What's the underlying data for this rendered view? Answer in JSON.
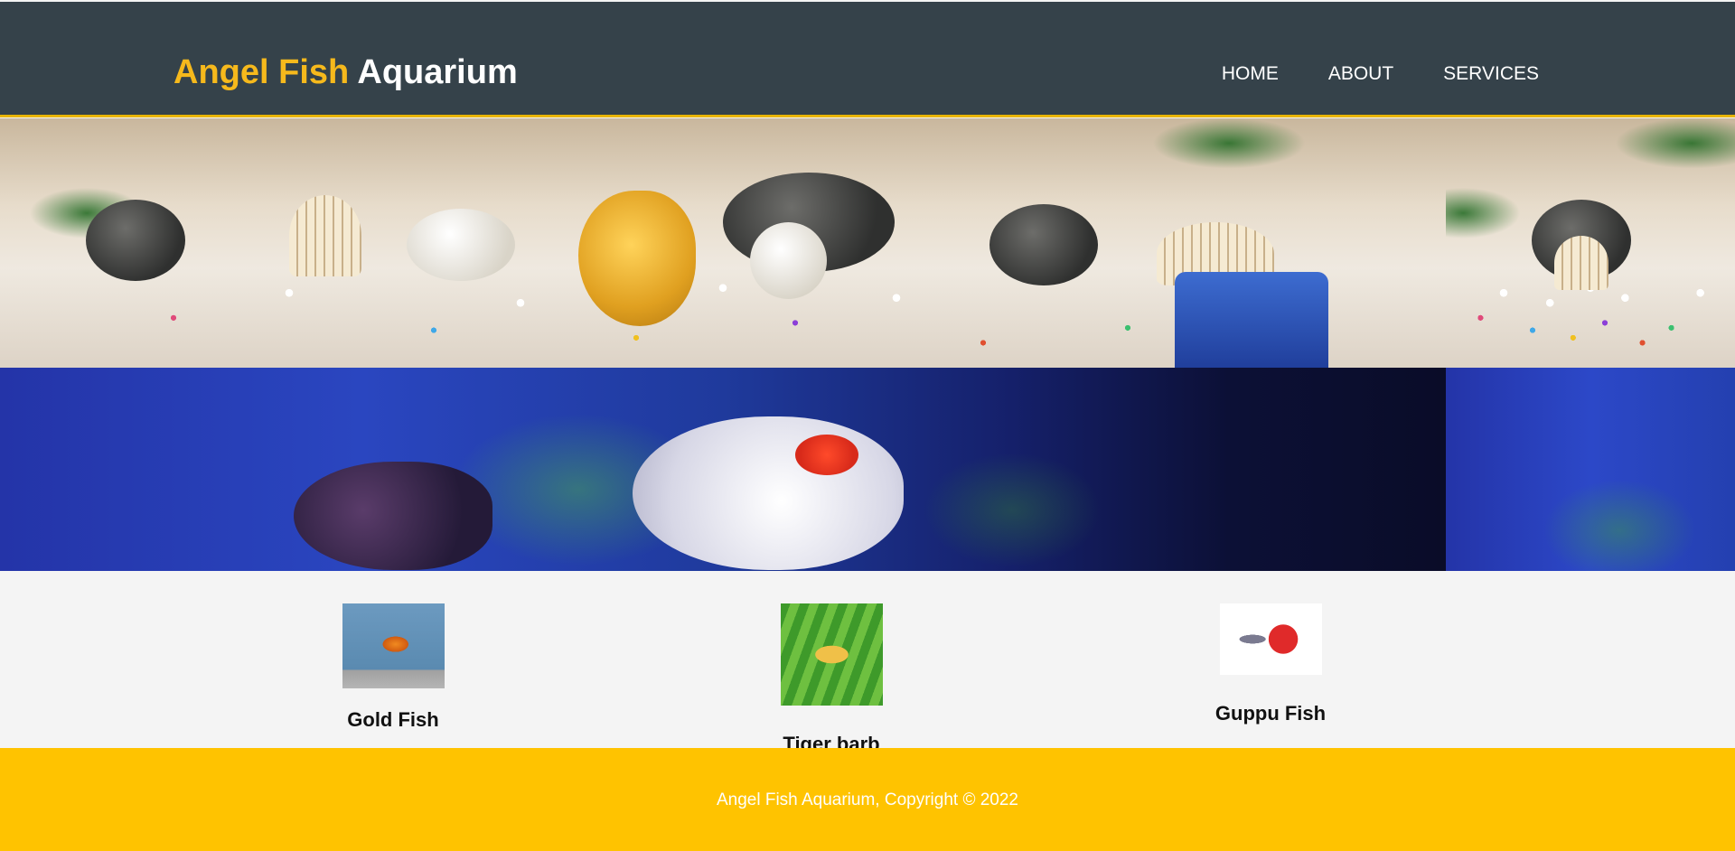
{
  "header": {
    "logo_highlight": "Angel Fish",
    "logo_rest": "Aquarium",
    "nav": [
      "HOME",
      "ABOUT",
      "SERVICES"
    ]
  },
  "products": [
    {
      "name": "Gold Fish"
    },
    {
      "name": "Tiger barb"
    },
    {
      "name": "Guppu Fish"
    }
  ],
  "footer": {
    "text": "Angel Fish Aquarium, Copyright © 2022"
  },
  "colors": {
    "header_bg": "#35424a",
    "accent": "#ffc300",
    "logo_highlight": "#f6b91c"
  }
}
